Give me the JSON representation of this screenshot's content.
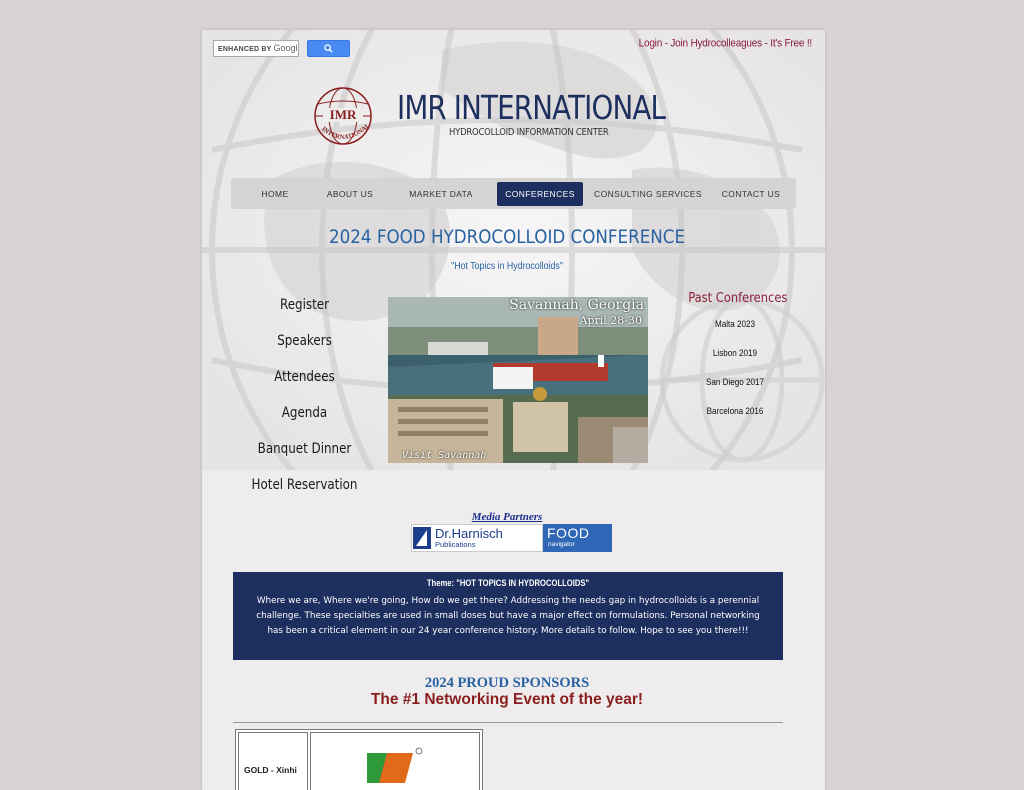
{
  "search": {
    "placeholder_prefix": "ENHANCED BY",
    "placeholder_brand": "Googl"
  },
  "top_link": "Login - Join Hydrocolleagues - It's Free !!",
  "brand": {
    "logo_text": "IMR",
    "logo_ring": "INTERNATIONAL",
    "title": "IMR INTERNATIONAL",
    "subtitle": "HYDROCOLLOID INFORMATION CENTER"
  },
  "nav": [
    {
      "label": "HOME",
      "active": false
    },
    {
      "label": "ABOUT US",
      "active": false
    },
    {
      "label": "MARKET DATA",
      "active": false
    },
    {
      "label": "CONFERENCES",
      "active": true
    },
    {
      "label": "CONSULTING SERVICES",
      "active": false
    },
    {
      "label": "CONTACT US",
      "active": false
    }
  ],
  "conference": {
    "title": "2024 FOOD HYDROCOLLOID CONFERENCE",
    "subtitle": "\"Hot Topics in Hydrocolloids\""
  },
  "left_menu": [
    "Register",
    "Speakers",
    "Attendees",
    "Agenda",
    "Banquet Dinner",
    "Hotel Reservation"
  ],
  "photo": {
    "city": "Savannah, Georgia",
    "dates": "April 28-30",
    "caption": "Visit Savannah"
  },
  "past": {
    "title": "Past Conferences",
    "items": [
      "Malta 2023",
      "Lisbon 2019",
      "San Diego 2017",
      "Barcelona 2016"
    ]
  },
  "media": {
    "title": "Media Partners",
    "harnisch_name": "Dr.Harnisch",
    "harnisch_sub": "Publications",
    "food_big": "FOOD",
    "food_small": "navigator"
  },
  "theme": {
    "title": "Theme: \"HOT TOPICS IN HYDROCOLLOIDS\"",
    "body": "Where we are, Where we're going, How do we get there? Addressing the needs gap in hydrocolloids is a perennial challenge. These specialties are used in small doses but have a major effect on formulations. Personal networking has been a critical element in our 24 year conference history. More details to follow. Hope to see you there!!!"
  },
  "sponsors": {
    "title": "2024 PROUD SPONSORS",
    "subtitle": "The #1 Networking Event of the year!",
    "first_cell": "GOLD - Xinhi"
  },
  "colors": {
    "navy": "#1c2f5e",
    "blue": "#2962a3",
    "maroon": "#8a1d3c"
  }
}
